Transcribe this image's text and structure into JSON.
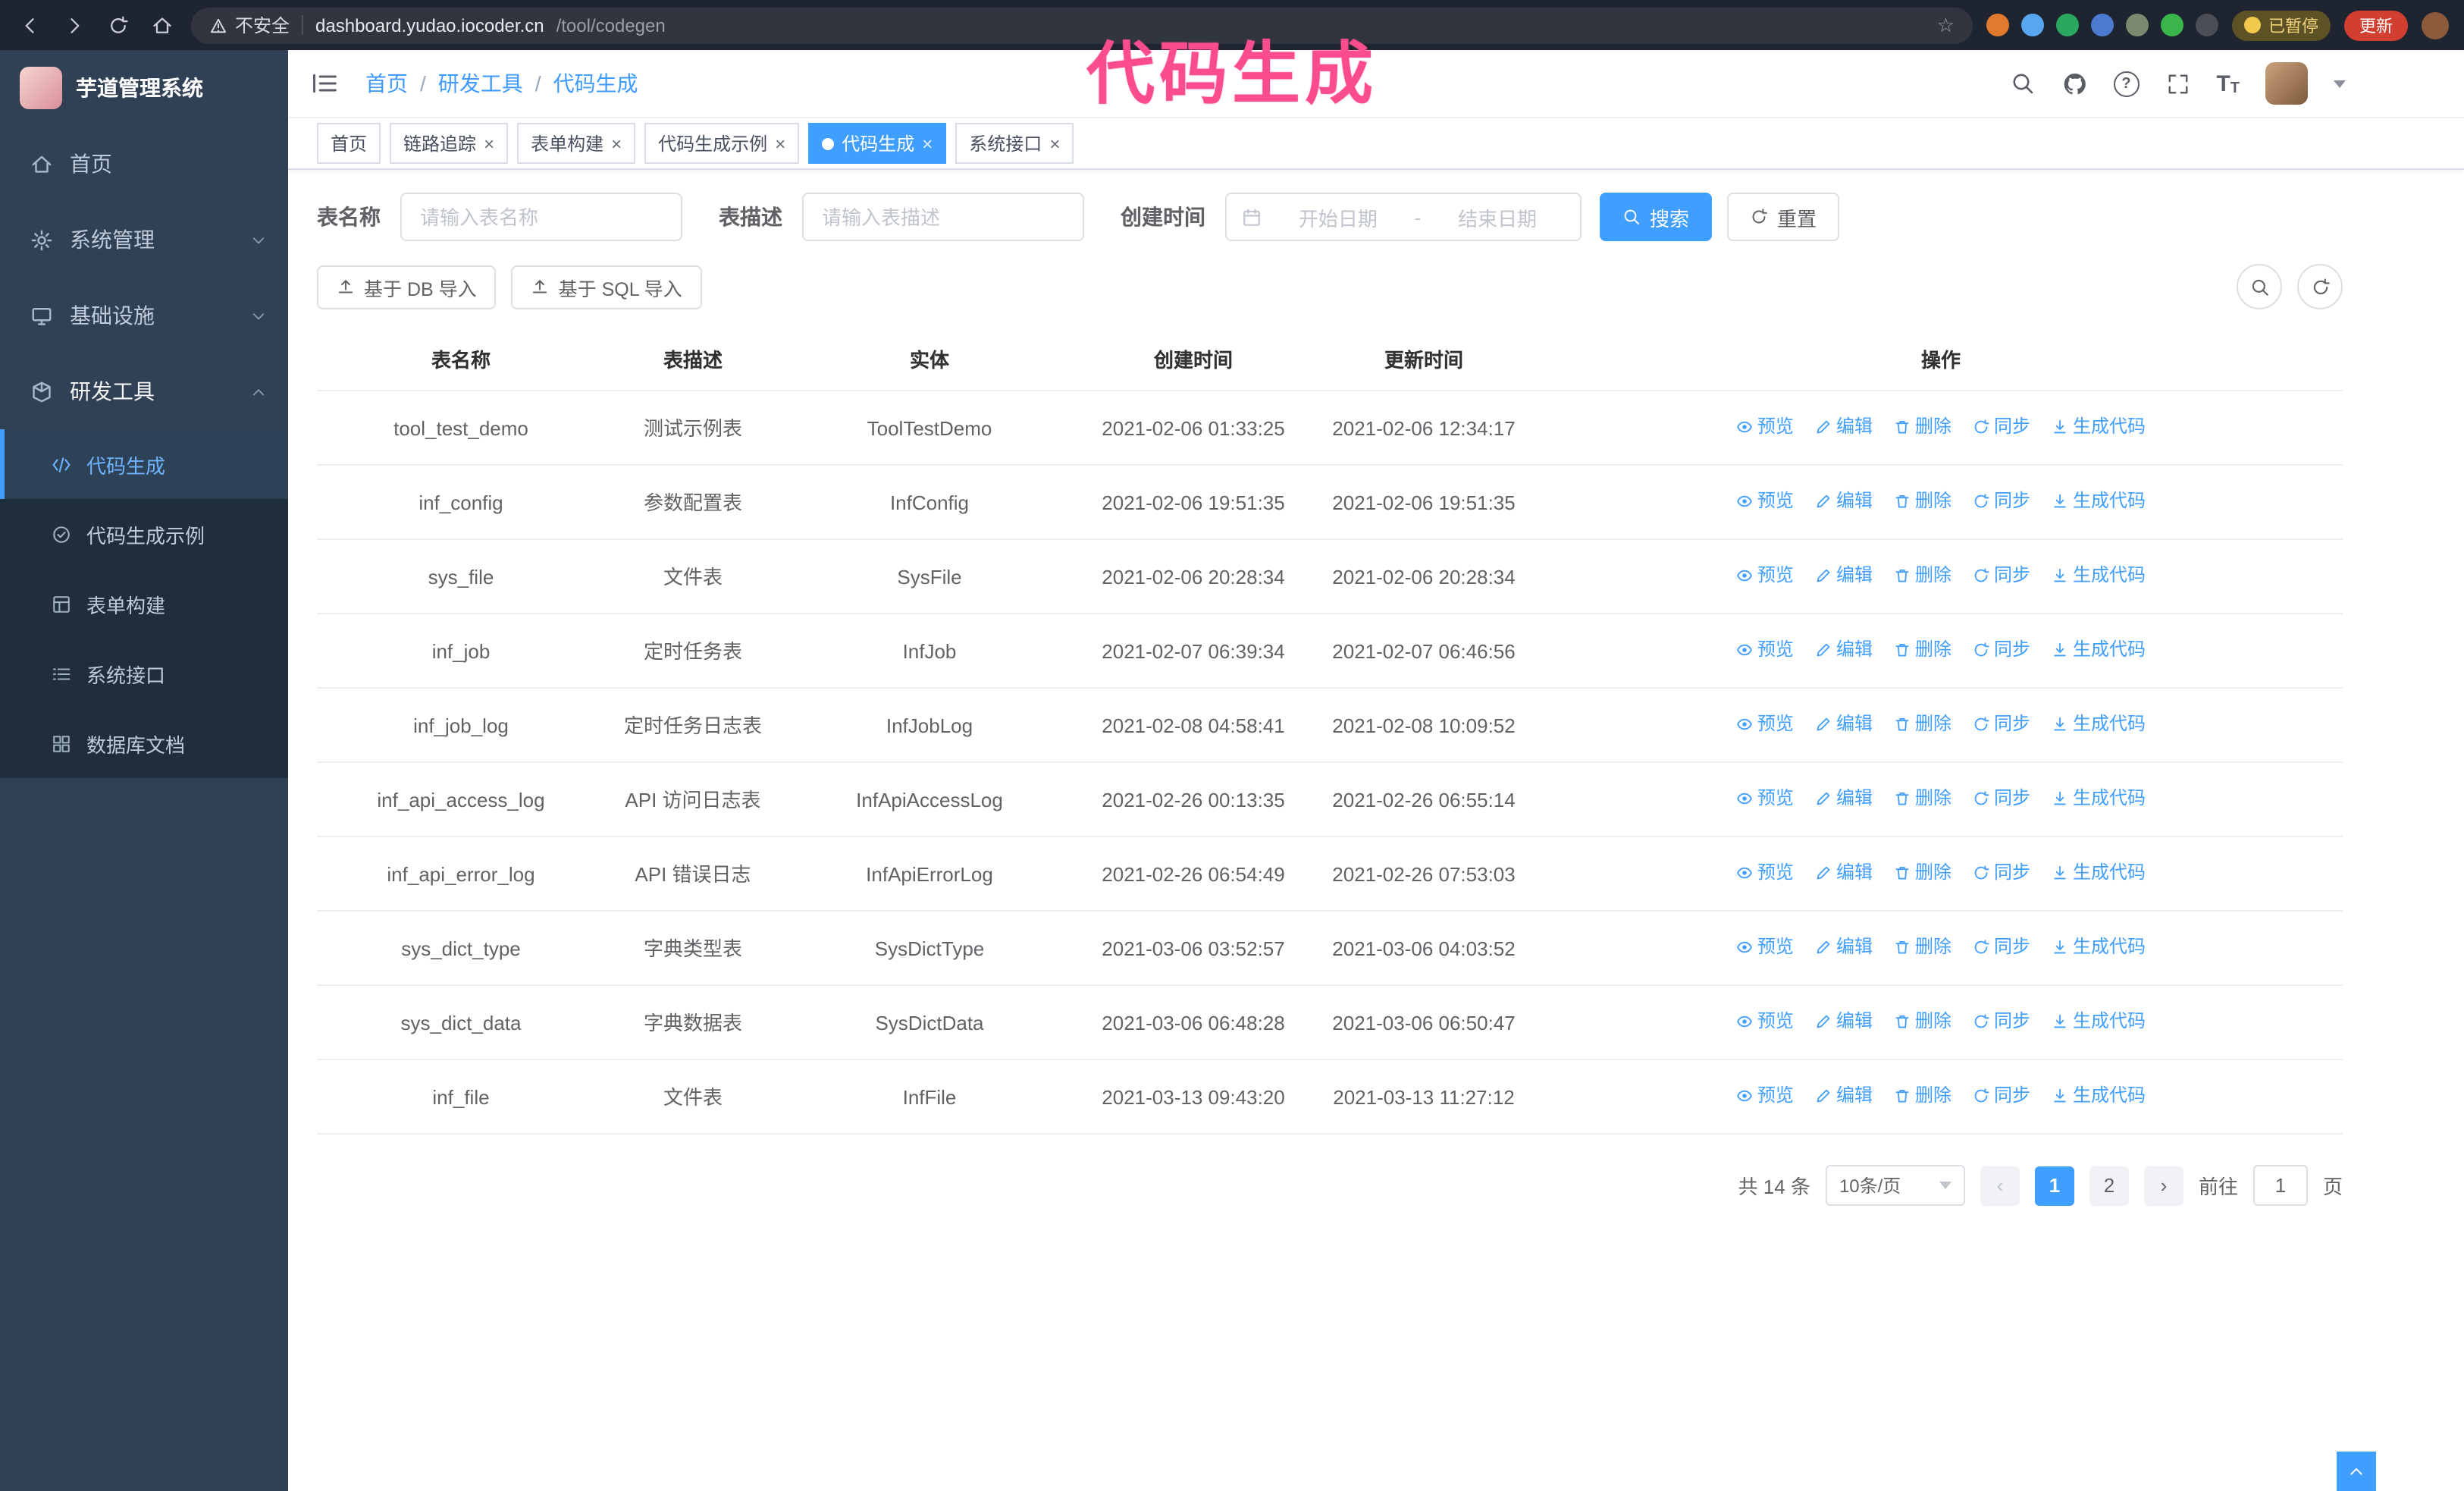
{
  "browser": {
    "security_label": "不安全",
    "url_host": "dashboard.yudao.iocoder.cn",
    "url_path": "/tool/codegen",
    "paused_badge": "已暂停",
    "update_button": "更新"
  },
  "annotation": {
    "text": "代码生成",
    "color": "#fb4d8e"
  },
  "sidebar": {
    "logo_title": "芋道管理系统",
    "items": [
      {
        "label": "首页"
      },
      {
        "label": "系统管理"
      },
      {
        "label": "基础设施"
      },
      {
        "label": "研发工具"
      }
    ],
    "sub_items": [
      {
        "label": "代码生成"
      },
      {
        "label": "代码生成示例"
      },
      {
        "label": "表单构建"
      },
      {
        "label": "系统接口"
      },
      {
        "label": "数据库文档"
      }
    ]
  },
  "breadcrumb": {
    "items": [
      "首页",
      "研发工具",
      "代码生成"
    ],
    "separator": "/"
  },
  "tabs": [
    {
      "label": "首页"
    },
    {
      "label": "链路追踪"
    },
    {
      "label": "表单构建"
    },
    {
      "label": "代码生成示例"
    },
    {
      "label": "代码生成"
    },
    {
      "label": "系统接口"
    }
  ],
  "filters": {
    "table_name_label": "表名称",
    "table_name_placeholder": "请输入表名称",
    "table_desc_label": "表描述",
    "table_desc_placeholder": "请输入表描述",
    "create_time_label": "创建时间",
    "date_start_placeholder": "开始日期",
    "date_separator": "-",
    "date_end_placeholder": "结束日期",
    "search_button": "搜索",
    "reset_button": "重置"
  },
  "toolbar": {
    "import_db_button": "基于 DB 导入",
    "import_sql_button": "基于 SQL 导入"
  },
  "table": {
    "columns": [
      "表名称",
      "表描述",
      "实体",
      "创建时间",
      "更新时间",
      "操作"
    ],
    "op_labels": [
      "预览",
      "编辑",
      "删除",
      "同步",
      "生成代码"
    ],
    "rows": [
      {
        "name": "tool_test_demo",
        "desc": "测试示例表",
        "entity": "ToolTestDemo",
        "create_time": "2021-02-06 01:33:25",
        "update_time": "2021-02-06 12:34:17"
      },
      {
        "name": "inf_config",
        "desc": "参数配置表",
        "entity": "InfConfig",
        "create_time": "2021-02-06 19:51:35",
        "update_time": "2021-02-06 19:51:35"
      },
      {
        "name": "sys_file",
        "desc": "文件表",
        "entity": "SysFile",
        "create_time": "2021-02-06 20:28:34",
        "update_time": "2021-02-06 20:28:34"
      },
      {
        "name": "inf_job",
        "desc": "定时任务表",
        "entity": "InfJob",
        "create_time": "2021-02-07 06:39:34",
        "update_time": "2021-02-07 06:46:56"
      },
      {
        "name": "inf_job_log",
        "desc": "定时任务日志表",
        "entity": "InfJobLog",
        "create_time": "2021-02-08 04:58:41",
        "update_time": "2021-02-08 10:09:52"
      },
      {
        "name": "inf_api_access_log",
        "desc": "API 访问日志表",
        "entity": "InfApiAccessLog",
        "create_time": "2021-02-26 00:13:35",
        "update_time": "2021-02-26 06:55:14"
      },
      {
        "name": "inf_api_error_log",
        "desc": "API 错误日志",
        "entity": "InfApiErrorLog",
        "create_time": "2021-02-26 06:54:49",
        "update_time": "2021-02-26 07:53:03"
      },
      {
        "name": "sys_dict_type",
        "desc": "字典类型表",
        "entity": "SysDictType",
        "create_time": "2021-03-06 03:52:57",
        "update_time": "2021-03-06 04:03:52"
      },
      {
        "name": "sys_dict_data",
        "desc": "字典数据表",
        "entity": "SysDictData",
        "create_time": "2021-03-06 06:48:28",
        "update_time": "2021-03-06 06:50:47"
      },
      {
        "name": "inf_file",
        "desc": "文件表",
        "entity": "InfFile",
        "create_time": "2021-03-13 09:43:20",
        "update_time": "2021-03-13 11:27:12"
      }
    ]
  },
  "pagination": {
    "total": "共 14 条",
    "page_size": "10条/页",
    "pages": [
      "1",
      "2"
    ],
    "active_page": "1",
    "goto_label": "前往",
    "goto_value": "1",
    "unit_label": "页"
  },
  "icons": {
    "search": "magnifier",
    "github": "octocat",
    "help": "question-circle",
    "fullscreen": "corner-brackets",
    "font_size": "TT",
    "preview": "eye",
    "edit": "pencil",
    "delete": "trash",
    "sync": "refresh-arrows",
    "generate": "download-arrow",
    "calendar": "calendar",
    "import": "upload-arrow",
    "reset": "refresh",
    "collapse": "hamburger"
  }
}
